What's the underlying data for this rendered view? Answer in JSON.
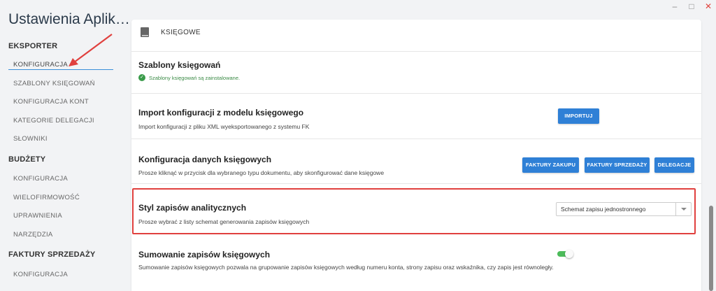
{
  "window": {
    "minimize": "–",
    "maximize": "□",
    "close": "✕"
  },
  "sidebar": {
    "app_title": "Ustawienia Aplik…",
    "sections": [
      {
        "title": "EKSPORTER",
        "items": [
          "KONFIGURACJA",
          "SZABLONY KSIĘGOWAŃ",
          "KONFIGURACJA KONT",
          "KATEGORIE DELEGACJI",
          "SŁOWNIKI"
        ]
      },
      {
        "title": "BUDŻETY",
        "items": [
          "KONFIGURACJA",
          "WIELOFIRMOWOŚĆ",
          "UPRAWNIENIA",
          "NARZĘDZIA"
        ]
      },
      {
        "title": "FAKTURY SPRZEDAŻY",
        "items": [
          "KONFIGURACJA"
        ]
      }
    ]
  },
  "card": {
    "title": "KSIĘGOWE",
    "icon": "book-icon",
    "rows": [
      {
        "title": "Szablony księgowań",
        "status": "Szablony księgowań są zainstalowane."
      },
      {
        "title": "Import konfiguracji z modelu księgowego",
        "desc": "Import konfiguracji z pliku XML wyeksportowanego z systemu FK",
        "button": "IMPORTUJ"
      },
      {
        "title": "Konfiguracja danych księgowych",
        "desc": "Prosze kliknąć w przycisk dla wybranego typu dokumentu, aby skonfigurować dane księgowe",
        "buttons": [
          "FAKTURY ZAKUPU",
          "FAKTURY SPRZEDAŻY",
          "DELEGACJE"
        ]
      },
      {
        "title": "Styl zapisów analitycznych",
        "desc": "Prosze wybrać z listy schemat generowania zapisów księgowych",
        "select_value": "Schemat zapisu jednostronnego"
      },
      {
        "title": "Sumowanie zapisów księgowych",
        "desc": "Sumowanie zapisów księgowych pozwala na grupowanie zapisów księgowych według numeru konta, strony zapisu oraz wskaźnika, czy zapis jest równoległy.",
        "toggle_on": true
      }
    ]
  },
  "colors": {
    "accent": "#2f80d6",
    "success": "#3a9b4a",
    "toggle": "#4cbb5a",
    "annotation": "#e0403e"
  }
}
